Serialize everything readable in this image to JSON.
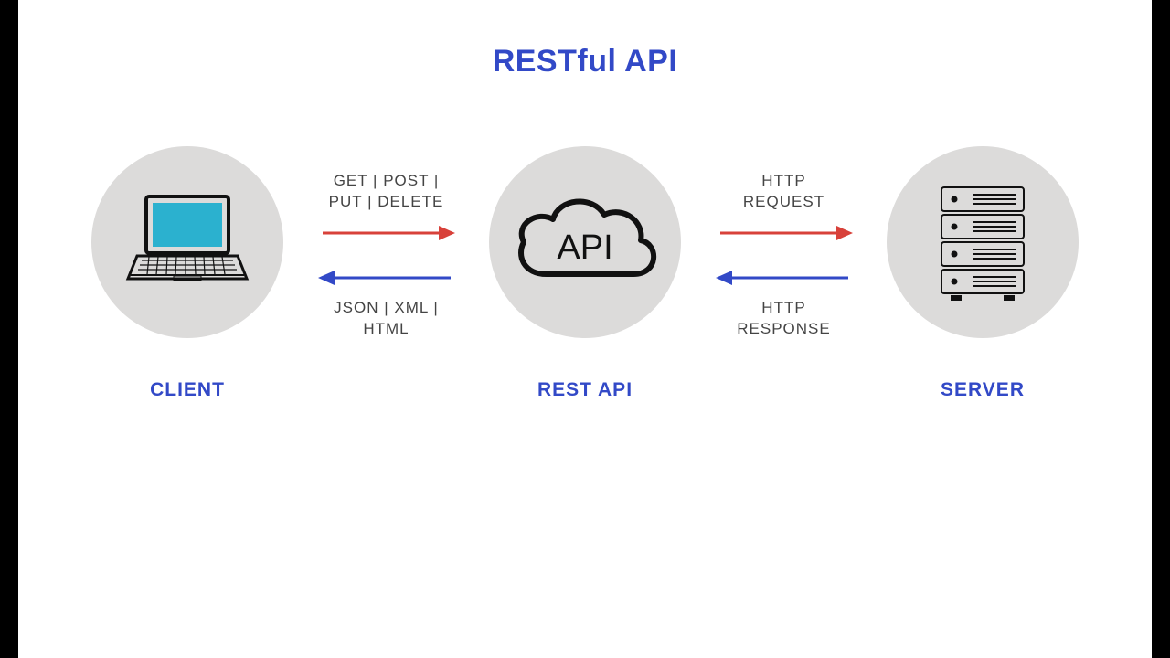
{
  "title": "RESTful API",
  "nodes": {
    "client": {
      "label": "CLIENT"
    },
    "api": {
      "label": "REST API",
      "cloud_text": "API"
    },
    "server": {
      "label": "SERVER"
    }
  },
  "arrows": {
    "client_to_api": {
      "label_line1": "GET | POST |",
      "label_line2": "PUT | DELETE"
    },
    "api_to_client": {
      "label_line1": "JSON | XML |",
      "label_line2": "HTML"
    },
    "api_to_server": {
      "label_line1": "HTTP",
      "label_line2": "REQUEST"
    },
    "server_to_api": {
      "label_line1": "HTTP",
      "label_line2": "RESPONSE"
    }
  },
  "colors": {
    "primary": "#3249c7",
    "request_arrow": "#d8413a",
    "response_arrow": "#3249c7",
    "circle_bg": "#dcdbda"
  }
}
